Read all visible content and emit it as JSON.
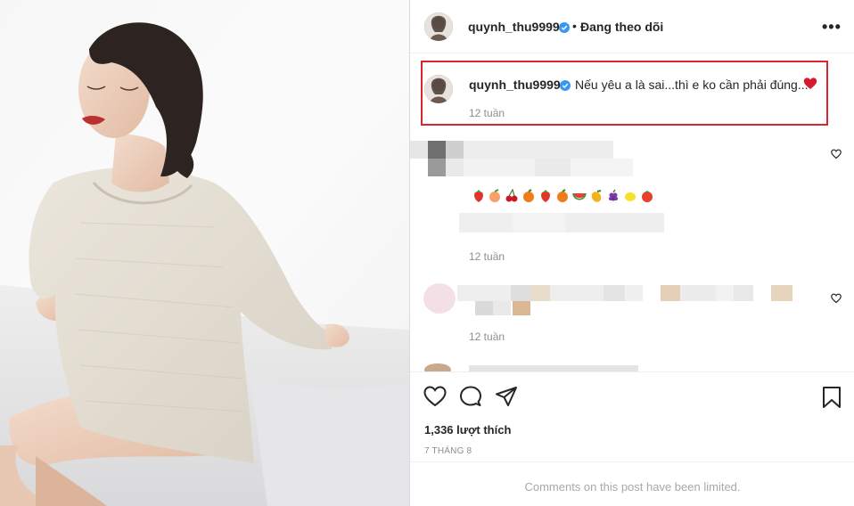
{
  "post": {
    "username": "quynh_thu9999",
    "follow_status": "Đang theo dõi",
    "dot": "•",
    "more_label": "•••"
  },
  "caption": {
    "username": "quynh_thu9999",
    "text": "Nếu yêu a là sai...thì e ko cần phải đúng...",
    "time": "12 tuần"
  },
  "comments": [
    {
      "time": "12 tuần",
      "emojis": [
        "strawberry",
        "peach",
        "cherries",
        "tangerine",
        "strawberry",
        "tangerine",
        "watermelon",
        "mango",
        "grapes",
        "lemon",
        "tomato"
      ]
    },
    {
      "time": "12 tuần"
    }
  ],
  "actions": {
    "likes": "1,336 lượt thích",
    "date": "7 THÁNG 8",
    "comments_limited": "Comments on this post have been limited."
  },
  "colors": {
    "accent_red": "#d9262c",
    "verified_blue": "#3897f0",
    "text": "#262626",
    "muted": "#8e8e8e"
  },
  "icons": [
    "verified-badge-icon",
    "more-options-icon",
    "red-heart-emoji-icon",
    "comment-like-icon",
    "like-icon",
    "comment-icon",
    "share-icon",
    "save-icon"
  ]
}
